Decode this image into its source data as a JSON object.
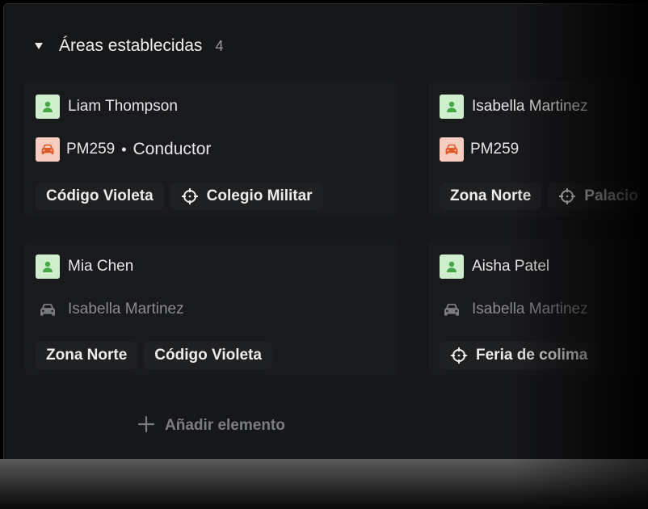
{
  "section": {
    "title": "Áreas establecidas",
    "count": "4",
    "add_label": "Añadir elemento"
  },
  "cards": [
    {
      "person": "Liam Thompson",
      "vehicle_code": "PM259",
      "vehicle_role": "Conductor",
      "tags": [
        {
          "label": "Código Violeta",
          "icon": ""
        },
        {
          "label": "Colegio Militar",
          "icon": "crosshair-icon"
        }
      ]
    },
    {
      "person": "Isabella Martinez",
      "vehicle_code": "PM259",
      "tags": [
        {
          "label": "Zona Norte",
          "icon": ""
        },
        {
          "label": "Palacio",
          "icon": "crosshair-icon"
        }
      ]
    },
    {
      "person": "Mia Chen",
      "vehicle_person": "Isabella Martinez",
      "tags": [
        {
          "label": "Zona Norte",
          "icon": ""
        },
        {
          "label": "Código Violeta",
          "icon": ""
        }
      ]
    },
    {
      "person": "Aisha Patel",
      "vehicle_person": "Isabella Martinez",
      "tags": [
        {
          "label": "Feria de colima",
          "icon": "crosshair-icon"
        }
      ]
    }
  ],
  "colors": {
    "panel_bg": "#161719",
    "card_bg": "#191a1c",
    "tag_bg": "#1f2022",
    "person_badge": "#cfeecd",
    "person_icon": "#45a844",
    "car_badge": "#f7cdbf",
    "car_icon": "#e0592a",
    "muted_text": "#8a8b8f"
  }
}
